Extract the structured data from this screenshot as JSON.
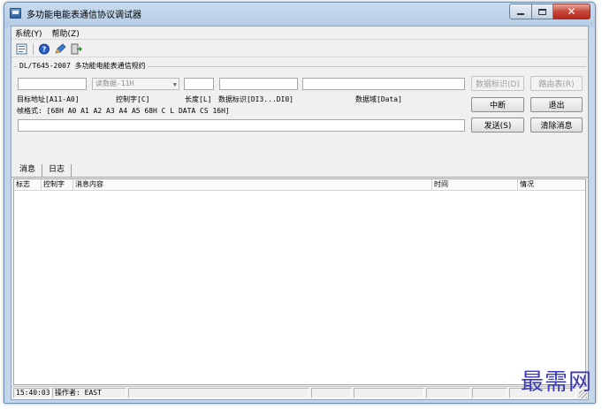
{
  "window": {
    "title": "多功能电能表通信协议调试器"
  },
  "menu": [
    {
      "label": "系统(Y)"
    },
    {
      "label": "帮助(Z)"
    }
  ],
  "protocol": {
    "group_title": "DL/T645-2007 多功能电能表通信规约",
    "command_select": "读数据-11H",
    "labels": {
      "target_address": "目标地址[A11-A0]",
      "control_code": "控制字[C]",
      "length": "长度[L]",
      "data_id": "数据标识[DI3...DI0]",
      "data_field": "数据域[Data]"
    },
    "frame_format": "帧格式: [68H A0 A1 A2 A3 A4 A5 68H C L DATA CS 16H]"
  },
  "buttons": {
    "data_id": "数据标识(D)",
    "route_table": "路由表(R)",
    "interrupt": "中断",
    "exit": "退出",
    "send": "发送(S)",
    "clear": "清除消息"
  },
  "tabs": [
    {
      "label": "消息"
    },
    {
      "label": "日志"
    }
  ],
  "grid": {
    "columns": [
      {
        "label": "标志"
      },
      {
        "label": "控制字"
      },
      {
        "label": "消息内容"
      },
      {
        "label": "时间"
      },
      {
        "label": "情况"
      }
    ]
  },
  "status": {
    "time": "15:40:03",
    "operator": "操作者: EAST"
  },
  "watermark": "最需网",
  "colors": {
    "title_gradient_top": "#c9dcef",
    "close_button": "#c7463a",
    "watermark": "#3b3bb8"
  },
  "icons": [
    "app-icon",
    "open-file-icon",
    "help-icon",
    "edit-icon",
    "exit-door-icon"
  ]
}
